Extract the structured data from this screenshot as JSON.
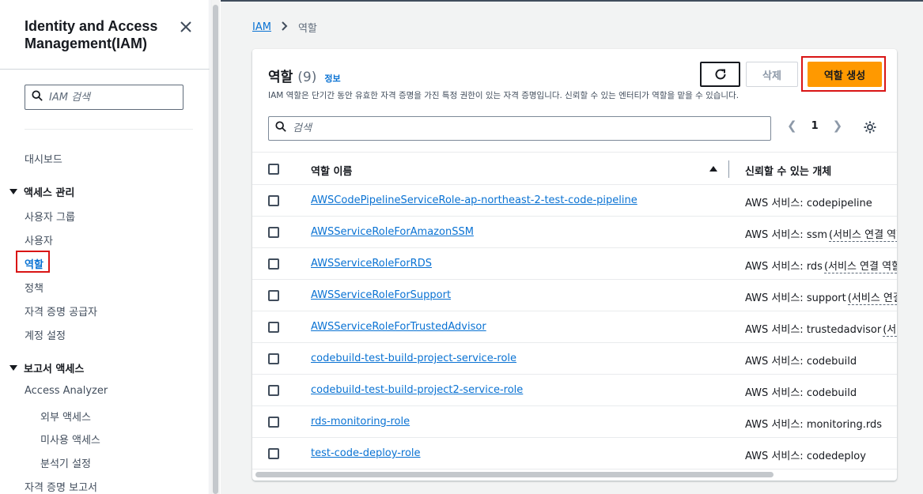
{
  "sidebar": {
    "title": "Identity and Access Management(IAM)",
    "search_placeholder": "IAM 검색",
    "dashboard": "대시보드",
    "access_section": "액세스 관리",
    "access_items": [
      "사용자 그룹",
      "사용자",
      "역할",
      "정책",
      "자격 증명 공급자",
      "계정 설정"
    ],
    "reports_section": "보고서 액세스",
    "access_analyzer": "Access Analyzer",
    "analyzer_items": [
      "외부 액세스",
      "미사용 액세스",
      "분석기 설정"
    ],
    "credential_report": "자격 증명 보고서"
  },
  "breadcrumb": {
    "root": "IAM",
    "current": "역할"
  },
  "panel": {
    "title": "역할",
    "count": "(9)",
    "info": "정보",
    "description": "IAM 역할은 단기간 동안 유효한 자격 증명을 가진 특정 권한이 있는 자격 증명입니다. 신뢰할 수 있는 엔터티가 역할을 맡을 수 있습니다.",
    "delete_label": "삭제",
    "create_label": "역할 생성",
    "search_placeholder": "검색",
    "page": "1"
  },
  "table": {
    "col_name": "역할 이름",
    "col_trusted": "신뢰할 수 있는 개체",
    "rows": [
      {
        "name": "AWSCodePipelineServiceRole-ap-northeast-2-test-code-pipeline",
        "trust": "AWS 서비스: codepipeline",
        "trust_suffix": ""
      },
      {
        "name": "AWSServiceRoleForAmazonSSM",
        "trust": "AWS 서비스: ssm",
        "trust_suffix": "(서비스 연결 역할)"
      },
      {
        "name": "AWSServiceRoleForRDS",
        "trust": "AWS 서비스: rds",
        "trust_suffix": "(서비스 연결 역할)"
      },
      {
        "name": "AWSServiceRoleForSupport",
        "trust": "AWS 서비스: support",
        "trust_suffix": "(서비스 연결 역할)"
      },
      {
        "name": "AWSServiceRoleForTrustedAdvisor",
        "trust": "AWS 서비스: trustedadvisor",
        "trust_suffix": "(서비스 연결 역할)"
      },
      {
        "name": "codebuild-test-build-project-service-role",
        "trust": "AWS 서비스: codebuild",
        "trust_suffix": ""
      },
      {
        "name": "codebuild-test-build-project2-service-role",
        "trust": "AWS 서비스: codebuild",
        "trust_suffix": ""
      },
      {
        "name": "rds-monitoring-role",
        "trust": "AWS 서비스: monitoring.rds",
        "trust_suffix": ""
      },
      {
        "name": "test-code-deploy-role",
        "trust": "AWS 서비스: codedeploy",
        "trust_suffix": ""
      }
    ]
  },
  "colors": {
    "link": "#0972d3",
    "primary": "#ff9900",
    "highlight": "#d91515"
  },
  "icons": {
    "close": "close-icon",
    "search": "search-icon",
    "refresh": "refresh-icon",
    "settings": "gear-icon"
  }
}
